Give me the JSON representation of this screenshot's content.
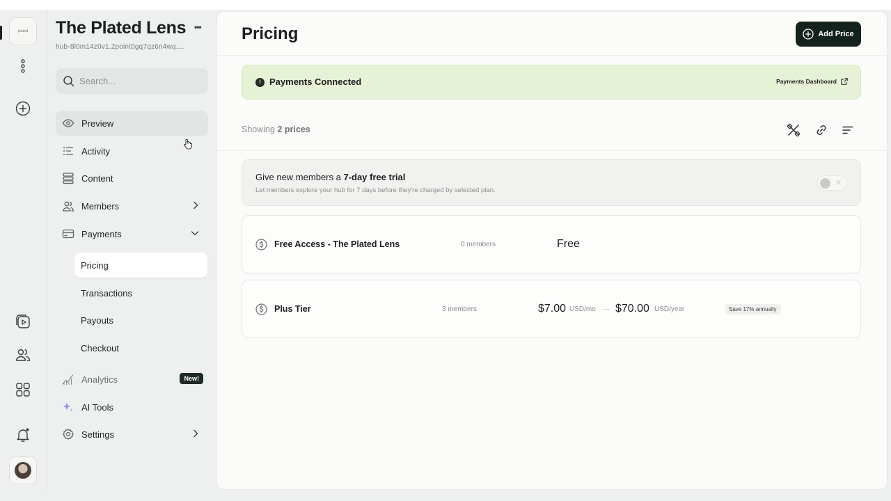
{
  "hub": {
    "logo_text": "plated",
    "name": "The Plated Lens",
    "more_label": "•••",
    "id": "hub-8l0m14z0v1.2point0gq7qz6n4wq...."
  },
  "search": {
    "placeholder": "Search..."
  },
  "nav": {
    "preview": "Preview",
    "activity": "Activity",
    "content": "Content",
    "members": "Members",
    "payments": "Payments",
    "payments_sub": {
      "pricing": "Pricing",
      "transactions": "Transactions",
      "payouts": "Payouts",
      "checkout": "Checkout"
    },
    "analytics": "Analytics",
    "analytics_badge": "New!",
    "ai_tools": "AI Tools",
    "settings": "Settings"
  },
  "page": {
    "title": "Pricing",
    "add_button": "Add Price"
  },
  "banner": {
    "status_icon": "!",
    "label": "Payments Connected",
    "link": "Payments Dashboard"
  },
  "toolbar": {
    "showing_prefix": "Showing",
    "showing_count": "2 prices"
  },
  "trial": {
    "title_prefix": "Give new members a",
    "title_bold": "7-day free trial",
    "description": "Let members explore your hub for 7 days before they're charged by selected plan.",
    "enabled": false,
    "toggle_off_symbol": "✕"
  },
  "prices": [
    {
      "name": "Free Access - The Plated Lens",
      "members": "0 members",
      "price": "Free"
    },
    {
      "name": "Plus Tier",
      "members": "3 members",
      "monthly_amount": "$7.00",
      "monthly_unit": "USD/mo",
      "yearly_amount": "$70.00",
      "yearly_unit": "USD/year",
      "badge": "Save 17% annually"
    }
  ],
  "colors": {
    "primary_button": "#14221c",
    "banner_bg": "#e6f1d6",
    "ai_sparkle": "#9b8cf0"
  }
}
